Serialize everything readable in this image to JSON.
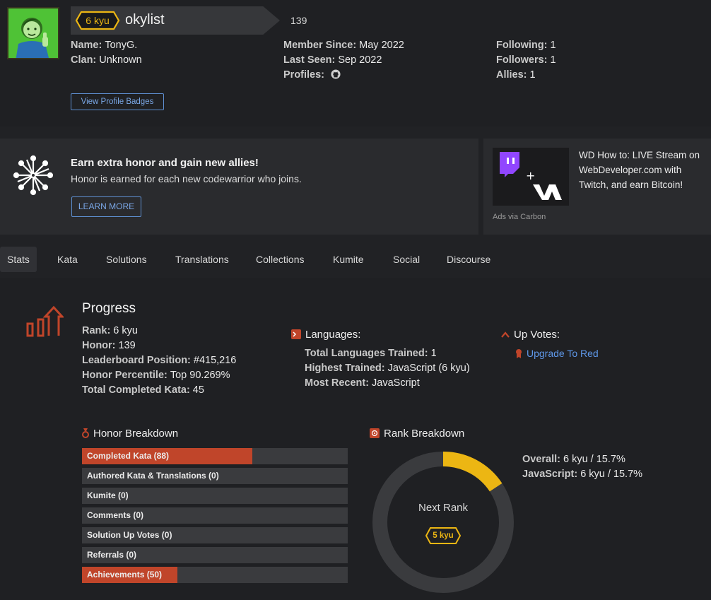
{
  "profile": {
    "rank_badge": "6 kyu",
    "username": "okylist",
    "honor": "139",
    "name_label": "Name:",
    "name": "TonyG.",
    "clan_label": "Clan:",
    "clan": "Unknown",
    "member_since_label": "Member Since:",
    "member_since": "May 2022",
    "last_seen_label": "Last Seen:",
    "last_seen": "Sep 2022",
    "profiles_label": "Profiles:",
    "following_label": "Following:",
    "following": "1",
    "followers_label": "Followers:",
    "followers": "1",
    "allies_label": "Allies:",
    "allies": "1",
    "badges_button": "View Profile Badges",
    "profile_icons": [
      "github-icon"
    ]
  },
  "promo": {
    "title": "Earn extra honor and gain new allies!",
    "subtitle": "Honor is earned for each new codewarrior who joins.",
    "button": "LEARN MORE"
  },
  "ad": {
    "text": "WD How to: LIVE Stream on WebDeveloper.com with Twitch, and earn Bitcoin!",
    "via": "Ads via Carbon"
  },
  "tabs": [
    {
      "label": "Stats",
      "active": true
    },
    {
      "label": "Kata"
    },
    {
      "label": "Solutions"
    },
    {
      "label": "Translations"
    },
    {
      "label": "Collections"
    },
    {
      "label": "Kumite"
    },
    {
      "label": "Social"
    },
    {
      "label": "Discourse"
    }
  ],
  "progress": {
    "title": "Progress",
    "rank_label": "Rank:",
    "rank": "6 kyu",
    "honor_label": "Honor:",
    "honor": "139",
    "leaderboard_label": "Leaderboard Position:",
    "leaderboard": "#415,216",
    "percentile_label": "Honor Percentile:",
    "percentile": "Top 90.269%",
    "completed_label": "Total Completed Kata:",
    "completed": "45"
  },
  "languages": {
    "title": "Languages:",
    "total_label": "Total Languages Trained:",
    "total": "1",
    "highest_label": "Highest Trained:",
    "highest": "JavaScript (6 kyu)",
    "recent_label": "Most Recent:",
    "recent": "JavaScript"
  },
  "upvotes": {
    "title": "Up Votes:",
    "link": "Upgrade To Red"
  },
  "honor_breakdown": {
    "title": "Honor Breakdown",
    "items": [
      {
        "label": "Completed Kata (88)",
        "fill": 0.64
      },
      {
        "label": "Authored Kata & Translations (0)",
        "fill": 0
      },
      {
        "label": "Kumite (0)",
        "fill": 0
      },
      {
        "label": "Comments (0)",
        "fill": 0
      },
      {
        "label": "Solution Up Votes (0)",
        "fill": 0
      },
      {
        "label": "Referrals (0)",
        "fill": 0
      },
      {
        "label": "Achievements (50)",
        "fill": 0.36
      }
    ]
  },
  "rank_breakdown": {
    "title": "Rank Breakdown",
    "overall_label": "Overall:",
    "overall": "6 kyu / 15.7%",
    "js_label": "JavaScript:",
    "js": "6 kyu / 15.7%",
    "progress_fraction": 0.157,
    "next_rank_label": "Next Rank",
    "next_rank": "5 kyu"
  },
  "colors": {
    "accent_red": "#c0452a",
    "rank_yellow": "#ecb613",
    "link_blue": "#5e97e8"
  }
}
